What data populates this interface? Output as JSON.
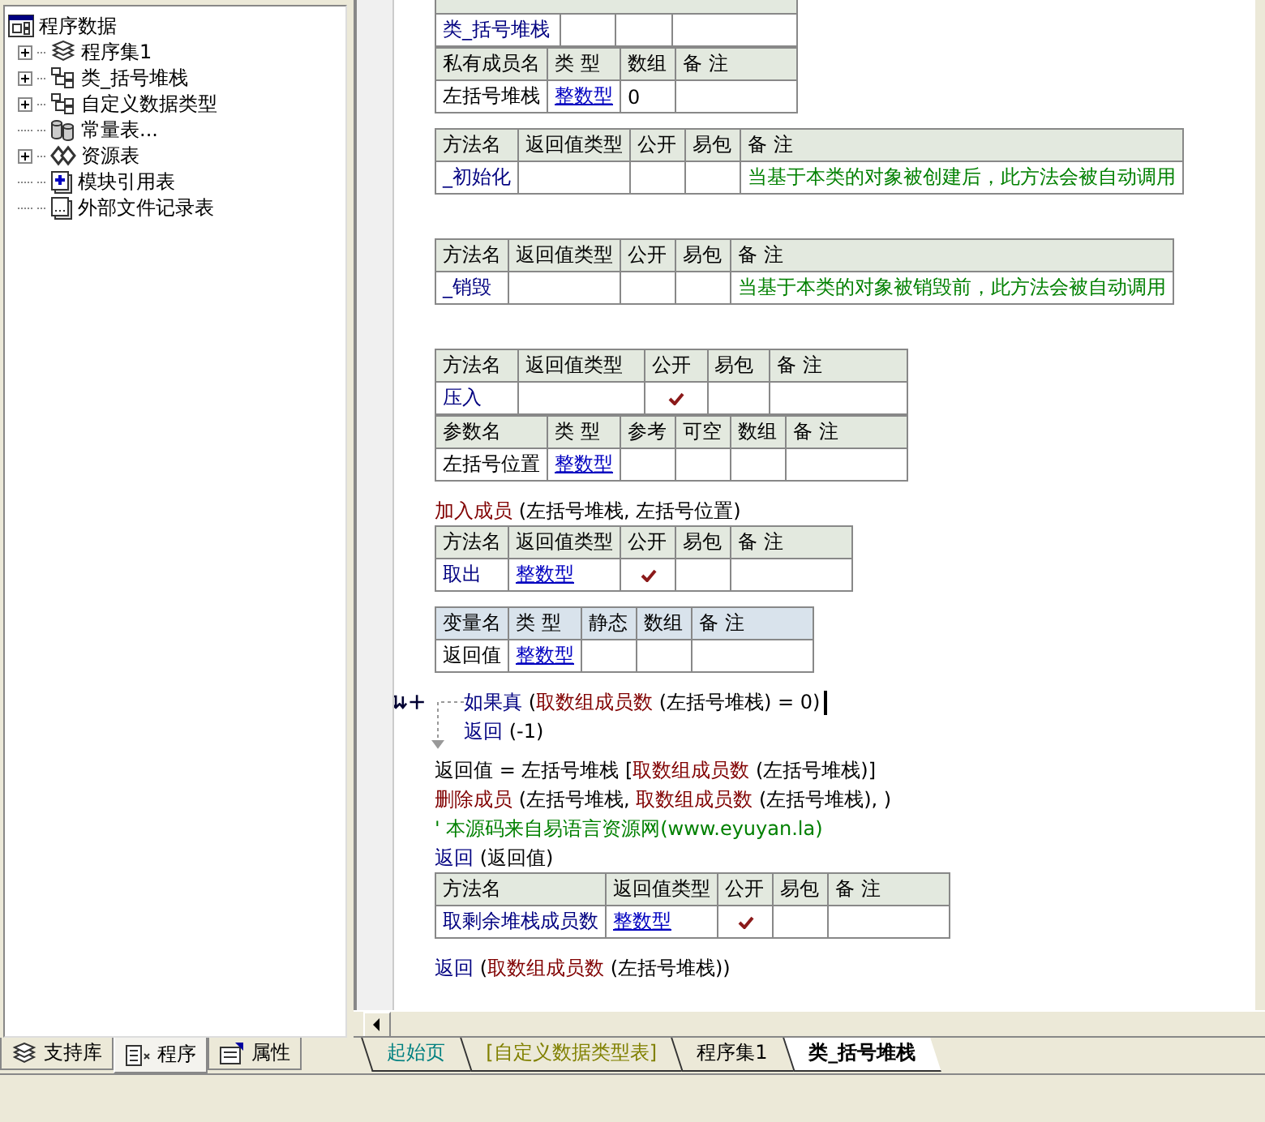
{
  "tree": {
    "root": {
      "label": "程序数据",
      "children": [
        {
          "label": "程序集1",
          "expanded": false
        },
        {
          "label": "类_括号堆栈",
          "expanded": false
        },
        {
          "label": "自定义数据类型",
          "expanded": false
        },
        {
          "label": "常量表..."
        },
        {
          "label": "资源表",
          "expanded": false
        },
        {
          "label": "模块引用表"
        },
        {
          "label": "外部文件记录表"
        }
      ]
    }
  },
  "panel_tabs": [
    {
      "label": "支持库",
      "selected": false
    },
    {
      "label": "程序",
      "selected": true
    },
    {
      "label": "属性",
      "selected": false
    }
  ],
  "code": [
    {
      "kind": "class_table",
      "sections": [
        {
          "rows": [
            [
              {
                "kind": "name",
                "text": "类_括号堆栈"
              },
              {
                "kind": "blank"
              },
              {
                "kind": "blank"
              },
              {
                "kind": "blank"
              }
            ]
          ]
        },
        {
          "header": [
            "私有成员名",
            "类 型",
            "数组",
            "备 注"
          ],
          "rows": [
            [
              {
                "kind": "plain",
                "text": "左括号堆栈"
              },
              {
                "kind": "type",
                "text": "整数型"
              },
              {
                "kind": "plain",
                "text": "0"
              },
              {
                "kind": "blank"
              }
            ]
          ]
        }
      ]
    },
    {
      "kind": "method_table",
      "sections": [
        {
          "header": [
            "方法名",
            "返回值类型",
            "公开",
            "易包",
            "备 注"
          ],
          "rows": [
            [
              {
                "kind": "name",
                "text": "_初始化"
              },
              {
                "kind": "blank"
              },
              {
                "kind": "check",
                "checked": false
              },
              {
                "kind": "blank"
              },
              {
                "kind": "comment",
                "text": "当基于本类的对象被创建后，此方法会被自动调用"
              }
            ]
          ]
        }
      ]
    },
    {
      "kind": "blank"
    },
    {
      "kind": "method_table",
      "sections": [
        {
          "header": [
            "方法名",
            "返回值类型",
            "公开",
            "易包",
            "备 注"
          ],
          "rows": [
            [
              {
                "kind": "name",
                "text": "_销毁"
              },
              {
                "kind": "blank"
              },
              {
                "kind": "check",
                "checked": false
              },
              {
                "kind": "blank"
              },
              {
                "kind": "comment",
                "text": "当基于本类的对象被销毁前，此方法会被自动调用"
              }
            ]
          ]
        }
      ]
    },
    {
      "kind": "blank"
    },
    {
      "kind": "method_table",
      "sections": [
        {
          "header": [
            "方法名",
            "返回值类型",
            "公开",
            "易包",
            "备 注"
          ],
          "rows": [
            [
              {
                "kind": "name",
                "text": "压入"
              },
              {
                "kind": "blank"
              },
              {
                "kind": "check",
                "checked": true
              },
              {
                "kind": "blank"
              },
              {
                "kind": "blank"
              }
            ]
          ]
        },
        {
          "header": [
            "参数名",
            "类 型",
            "参考",
            "可空",
            "数组",
            "备 注"
          ],
          "rows": [
            [
              {
                "kind": "plain",
                "text": "左括号位置"
              },
              {
                "kind": "type",
                "text": "整数型"
              },
              {
                "kind": "blank"
              },
              {
                "kind": "blank"
              },
              {
                "kind": "blank"
              },
              {
                "kind": "blank"
              }
            ]
          ]
        }
      ]
    },
    {
      "kind": "line",
      "segments": [
        {
          "kind": "call",
          "text": "加入成员"
        },
        {
          "kind": "plain",
          "text": " (左括号堆栈, 左括号位置)"
        }
      ]
    },
    {
      "kind": "method_table",
      "sections": [
        {
          "header": [
            "方法名",
            "返回值类型",
            "公开",
            "易包",
            "备 注"
          ],
          "rows": [
            [
              {
                "kind": "name",
                "text": "取出"
              },
              {
                "kind": "type",
                "text": "整数型"
              },
              {
                "kind": "check",
                "checked": true
              },
              {
                "kind": "blank"
              },
              {
                "kind": "blank"
              }
            ]
          ]
        }
      ]
    },
    {
      "kind": "variable_table",
      "sections": [
        {
          "header": [
            "变量名",
            "类 型",
            "静态",
            "数组",
            "备 注"
          ],
          "rows": [
            [
              {
                "kind": "plain",
                "text": "返回值"
              },
              {
                "kind": "type",
                "text": "整数型"
              },
              {
                "kind": "blank"
              },
              {
                "kind": "blank"
              },
              {
                "kind": "blank"
              }
            ]
          ]
        }
      ]
    },
    {
      "kind": "if",
      "current": true,
      "segments": [
        {
          "kind": "keyword",
          "text": "如果真"
        },
        {
          "kind": "plain",
          "text": " ("
        },
        {
          "kind": "call",
          "text": "取数组成员数"
        },
        {
          "kind": "plain",
          "text": " (左括号堆栈) = 0)"
        }
      ],
      "children": [
        {
          "kind": "line",
          "segments": [
            {
              "kind": "keyword",
              "text": "返回"
            },
            {
              "kind": "plain",
              "text": " (-1)"
            }
          ]
        }
      ]
    },
    {
      "kind": "line",
      "segments": [
        {
          "kind": "plain",
          "text": "返回值 = 左括号堆栈 ["
        },
        {
          "kind": "call",
          "text": "取数组成员数"
        },
        {
          "kind": "plain",
          "text": " (左括号堆栈)]"
        }
      ]
    },
    {
      "kind": "line",
      "segments": [
        {
          "kind": "call",
          "text": "删除成员"
        },
        {
          "kind": "plain",
          "text": " (左括号堆栈, "
        },
        {
          "kind": "call",
          "text": "取数组成员数"
        },
        {
          "kind": "plain",
          "text": " (左括号堆栈), )"
        }
      ]
    },
    {
      "kind": "line",
      "segments": [
        {
          "kind": "comment",
          "text": "' 本源码来自易语言资源网(www.eyuyan.la)"
        }
      ]
    },
    {
      "kind": "line",
      "segments": [
        {
          "kind": "keyword",
          "text": "返回"
        },
        {
          "kind": "plain",
          "text": " (返回值)"
        }
      ]
    },
    {
      "kind": "method_table",
      "sections": [
        {
          "header": [
            "方法名",
            "返回值类型",
            "公开",
            "易包",
            "备 注"
          ],
          "rows": [
            [
              {
                "kind": "name",
                "text": "取剩余堆栈成员数"
              },
              {
                "kind": "type",
                "text": "整数型"
              },
              {
                "kind": "check",
                "checked": true
              },
              {
                "kind": "blank"
              },
              {
                "kind": "blank"
              }
            ]
          ]
        }
      ]
    },
    {
      "kind": "line",
      "segments": [
        {
          "kind": "keyword",
          "text": "返回"
        },
        {
          "kind": "plain",
          "text": " ("
        },
        {
          "kind": "call",
          "text": "取数组成员数"
        },
        {
          "kind": "plain",
          "text": " (左括号堆栈))"
        }
      ]
    }
  ],
  "doc_tabs": [
    {
      "label": "起始页",
      "color": "#008080",
      "selected": false
    },
    {
      "label": "[自定义数据类型表]",
      "color": "#808000",
      "selected": false
    },
    {
      "label": "程序集1",
      "color": "#000000",
      "selected": false
    },
    {
      "label": "类_括号堆栈",
      "color": "#000000",
      "selected": true
    }
  ]
}
